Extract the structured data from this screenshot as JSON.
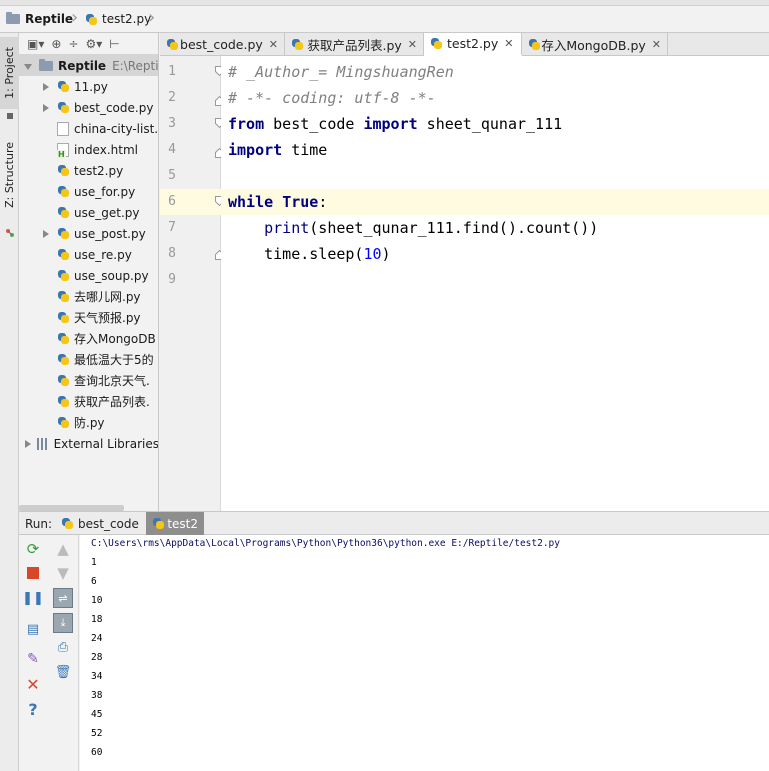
{
  "navbar": {
    "project_name": "Reptile",
    "file_name": "test2.py"
  },
  "left_strip": {
    "project_tab": "1: Project",
    "structure_tab": "Z: Structure"
  },
  "project_panel": {
    "root": {
      "name": "Reptile",
      "path": "E:\\Repti"
    },
    "items": [
      {
        "name": "11.py",
        "type": "python",
        "expandable": true
      },
      {
        "name": "best_code.py",
        "type": "python",
        "expandable": true
      },
      {
        "name": "china-city-list.",
        "type": "file",
        "expandable": false
      },
      {
        "name": "index.html",
        "type": "html",
        "expandable": false
      },
      {
        "name": "test2.py",
        "type": "python",
        "expandable": false
      },
      {
        "name": "use_for.py",
        "type": "python",
        "expandable": false
      },
      {
        "name": "use_get.py",
        "type": "python",
        "expandable": false
      },
      {
        "name": "use_post.py",
        "type": "python",
        "expandable": true
      },
      {
        "name": "use_re.py",
        "type": "python",
        "expandable": false
      },
      {
        "name": "use_soup.py",
        "type": "python",
        "expandable": false
      },
      {
        "name": "去哪儿网.py",
        "type": "python",
        "expandable": false
      },
      {
        "name": "天气预报.py",
        "type": "python",
        "expandable": false
      },
      {
        "name": "存入MongoDB",
        "type": "python",
        "expandable": false
      },
      {
        "name": "最低温大于5的",
        "type": "python",
        "expandable": false
      },
      {
        "name": "查询北京天气.",
        "type": "python",
        "expandable": false
      },
      {
        "name": "获取产品列表.",
        "type": "python",
        "expandable": false
      },
      {
        "name": "防.py",
        "type": "python",
        "expandable": false
      }
    ],
    "external_libraries": "External Libraries"
  },
  "editor_tabs": [
    {
      "label": "best_code.py",
      "active": false
    },
    {
      "label": "获取产品列表.py",
      "active": false
    },
    {
      "label": "test2.py",
      "active": true
    },
    {
      "label": "存入MongoDB.py",
      "active": false
    }
  ],
  "editor": {
    "line_numbers": [
      "1",
      "2",
      "3",
      "4",
      "5",
      "6",
      "7",
      "8",
      "9"
    ],
    "lines": {
      "l1": "# _Author_= MingshuangRen",
      "l2": "# -*- coding: utf-8 -*-",
      "l3_kw1": "from",
      "l3_mid": " best_code ",
      "l3_kw2": "import",
      "l3_end": " sheet_qunar_111",
      "l4_kw": "import",
      "l4_end": " time",
      "l6_kw1": "while",
      "l6_sp": " ",
      "l6_kw2": "True",
      "l6_end": ":",
      "l7_indent": "    ",
      "l7_fn": "print",
      "l7_end": "(sheet_qunar_111.find().count())",
      "l8_indent": "    ",
      "l8_start": "time.sleep(",
      "l8_num": "10",
      "l8_end": ")"
    }
  },
  "run_panel": {
    "run_label": "Run:",
    "tabs": [
      {
        "label": "best_code",
        "active": false
      },
      {
        "label": "test2",
        "active": true
      }
    ],
    "console": {
      "command": "C:\\Users\\rms\\AppData\\Local\\Programs\\Python\\Python36\\python.exe E:/Reptile/test2.py",
      "output": [
        "1",
        "6",
        "10",
        "18",
        "24",
        "28",
        "34",
        "38",
        "45",
        "52",
        "60"
      ]
    }
  },
  "colors": {
    "python_blue": "#3a76b0",
    "python_yellow": "#f5c518",
    "keyword": "#000080",
    "comment": "#808080",
    "number": "#0000ff",
    "caret_row": "#fffbe0"
  }
}
